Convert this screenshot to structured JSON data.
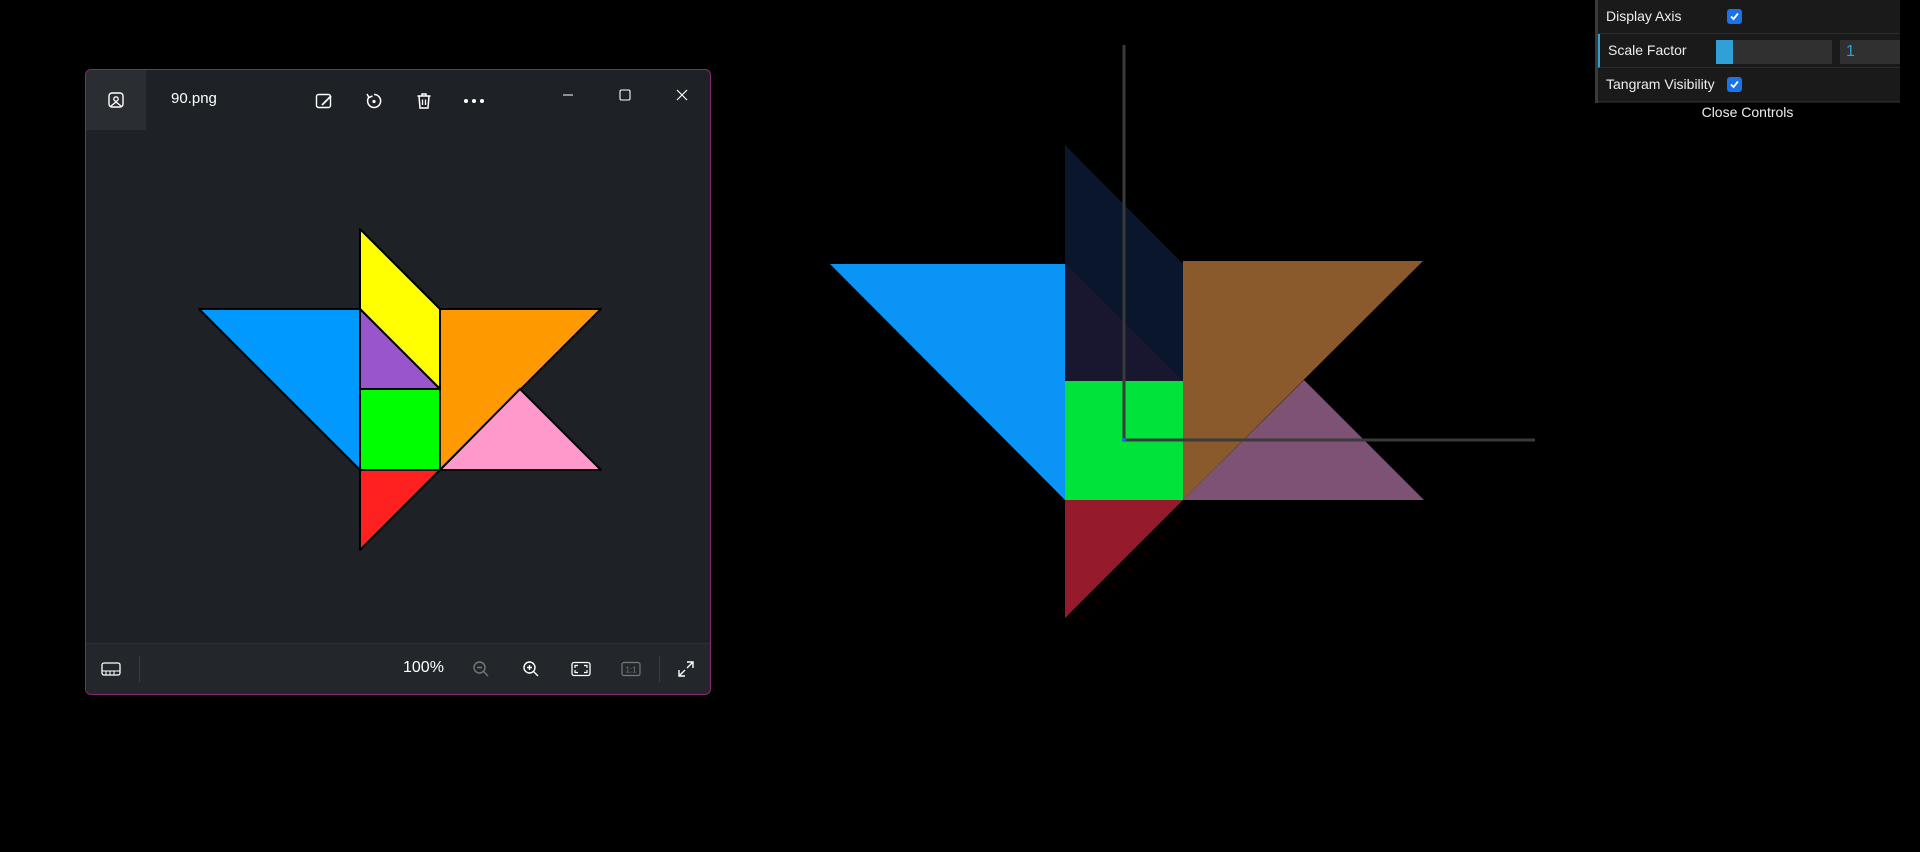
{
  "viewer": {
    "filename": "90.png",
    "zoom": "100%",
    "toolbar": [
      "edit-image",
      "rotate",
      "delete",
      "more-options"
    ],
    "window_controls": [
      "minimize",
      "maximize",
      "close"
    ],
    "bottom_controls": [
      "filmstrip",
      "zoom-out",
      "zoom-in",
      "fit-to-window",
      "actual-size",
      "full-screen"
    ]
  },
  "tangram_colors": {
    "blue": "#0099ff",
    "yellow": "#ffff00",
    "orange": "#ff9900",
    "purple": "#9955cc",
    "green": "#00ff00",
    "pink": "#ff99cc",
    "red": "#ff2020"
  },
  "controls": {
    "display_axis_label": "Display Axis",
    "display_axis_checked": true,
    "scale_factor_label": "Scale Factor",
    "scale_factor_value": "1",
    "scale_factor_fraction": 0.15,
    "tangram_visibility_label": "Tangram Visibility",
    "tangram_visibility_checked": true,
    "close_label": "Close Controls"
  }
}
